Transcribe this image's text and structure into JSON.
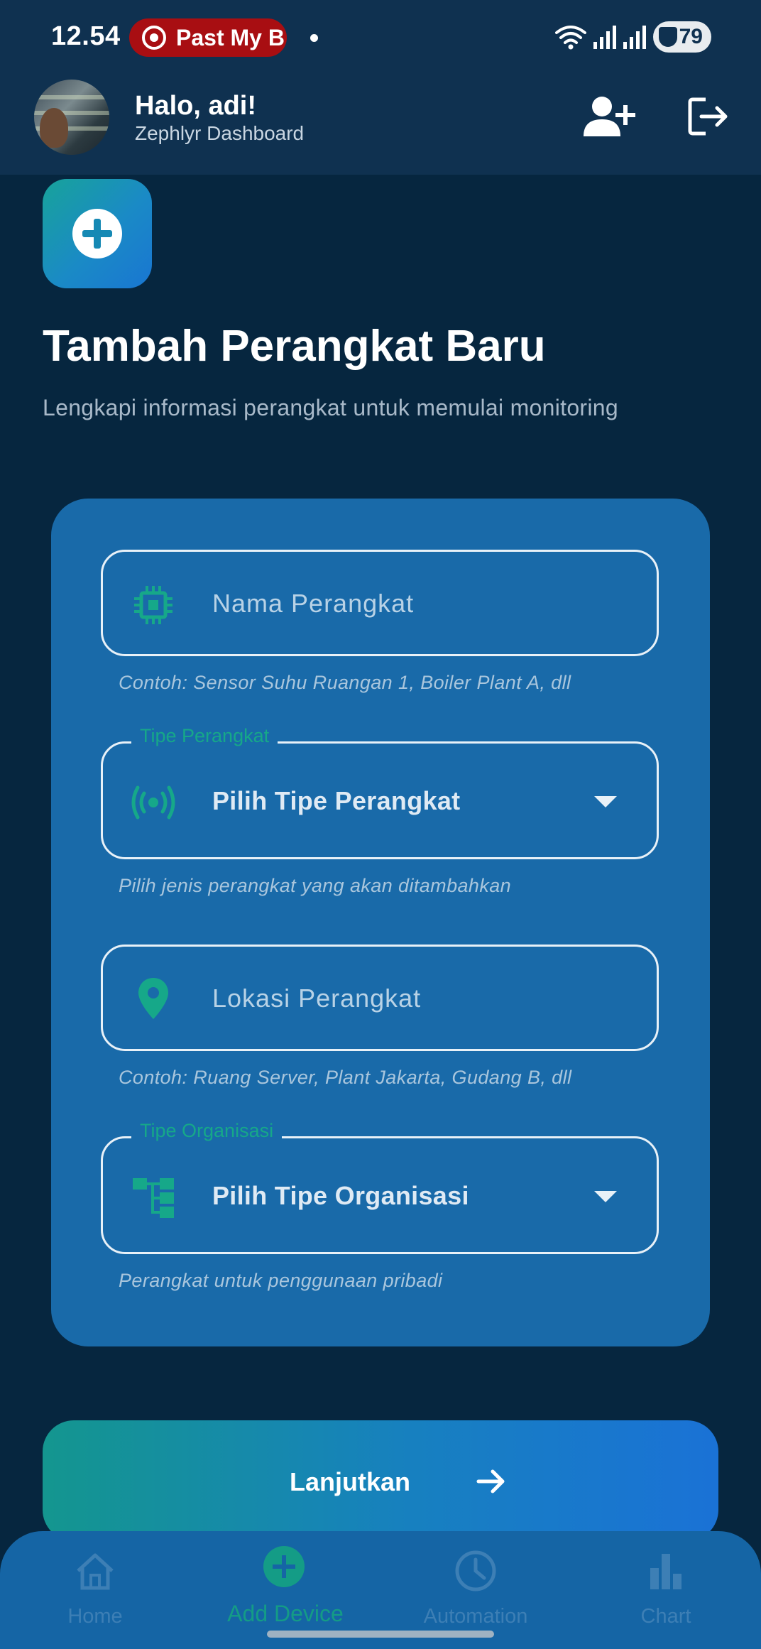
{
  "status_bar": {
    "time": "12.54",
    "media_chip_text": "Past My B",
    "battery_level": "79"
  },
  "header": {
    "greeting": "Halo, adi!",
    "subtitle": "Zephlyr Dashboard",
    "add_user_icon": "person-add-icon",
    "logout_icon": "logout-icon"
  },
  "page": {
    "title": "Tambah Perangkat Baru",
    "description": "Lengkapi informasi perangkat untuk memulai monitoring"
  },
  "form": {
    "device_name": {
      "icon": "chip-icon",
      "placeholder": "Nama Perangkat",
      "helper": "Contoh: Sensor Suhu Ruangan 1, Boiler Plant A, dll"
    },
    "device_type": {
      "label": "Tipe Perangkat",
      "icon": "sensor-icon",
      "value": "Pilih Tipe Perangkat",
      "helper": "Pilih jenis perangkat yang akan ditambahkan"
    },
    "device_location": {
      "icon": "location-pin-icon",
      "placeholder": "Lokasi Perangkat",
      "helper": "Contoh: Ruang Server, Plant Jakarta, Gudang B, dll"
    },
    "organization_type": {
      "label": "Tipe Organisasi",
      "icon": "hierarchy-icon",
      "value": "Pilih Tipe Organisasi",
      "helper": "Perangkat untuk penggunaan pribadi"
    }
  },
  "continue_button": {
    "label": "Lanjutkan",
    "icon": "arrow-right-icon"
  },
  "bottom_nav": {
    "items": [
      {
        "label": "Home",
        "icon": "home-icon"
      },
      {
        "label": "Add Device",
        "icon": "add-circle-icon",
        "active": true
      },
      {
        "label": "Automation",
        "icon": "clock-icon"
      },
      {
        "label": "Chart",
        "icon": "bar-chart-icon"
      }
    ]
  },
  "colors": {
    "background": "#06263f",
    "header": "#0f3150",
    "card": "#196aa9",
    "accent_green": "#16a889",
    "accent_blue": "#1976d2"
  }
}
